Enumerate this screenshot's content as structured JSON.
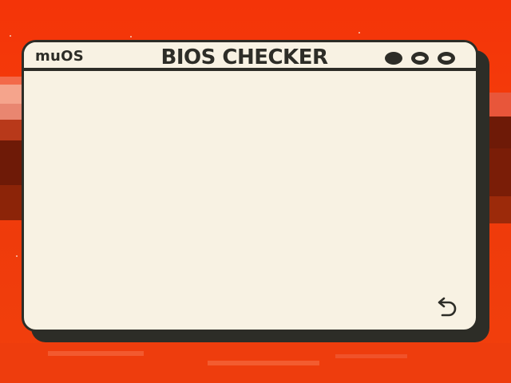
{
  "window": {
    "brand": "muOS",
    "title": "BIOS CHECKER",
    "controls": [
      "minimize",
      "maximize",
      "close"
    ]
  },
  "icons": {
    "back": "return-arrow-icon"
  },
  "colors": {
    "background": "#f23a0c",
    "window_fill": "#f8f2e3",
    "window_ink": "#2d2d27"
  }
}
